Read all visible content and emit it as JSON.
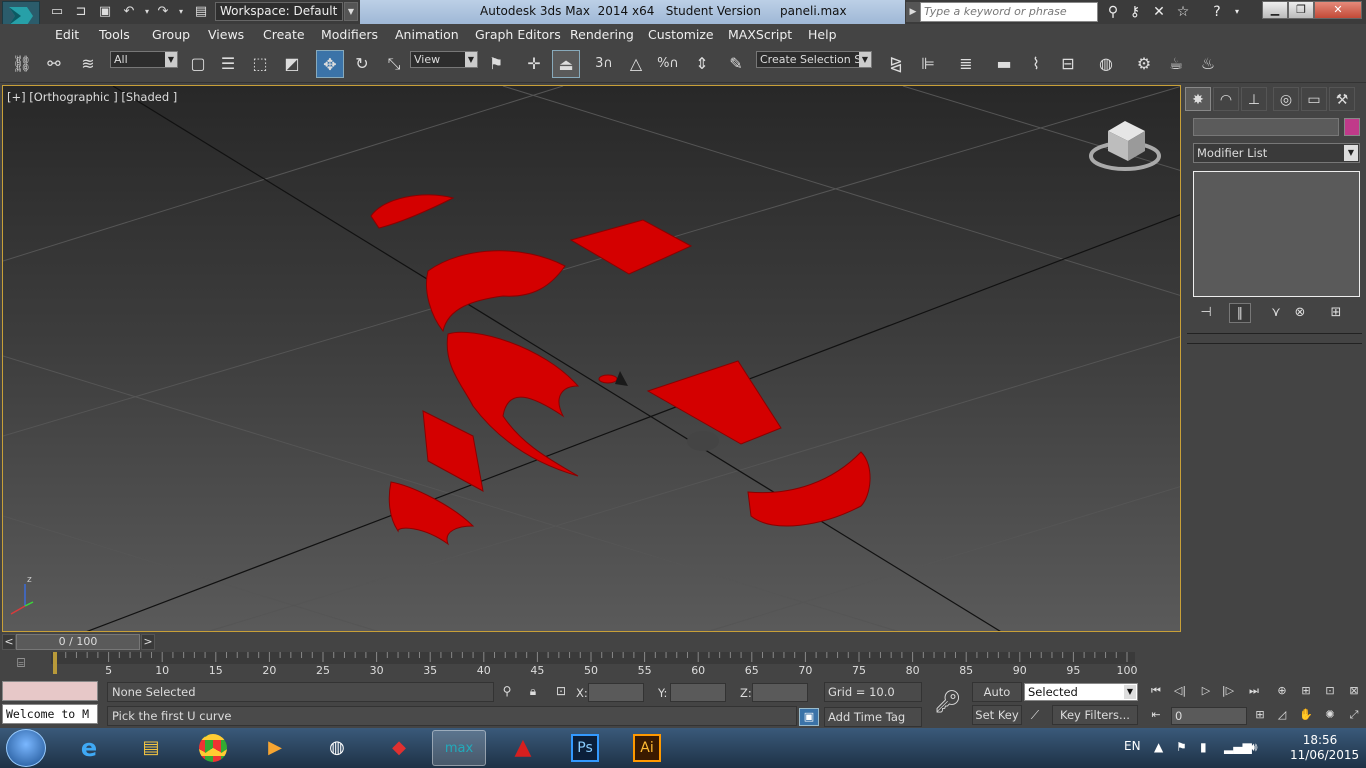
{
  "title": {
    "workspace": "Workspace: Default",
    "app_title": "Autodesk 3ds Max  2014 x64   Student Version     paneli.max",
    "search_placeholder": "Type a keyword or phrase"
  },
  "menu": [
    "Edit",
    "Tools",
    "Group",
    "Views",
    "Create",
    "Modifiers",
    "Animation",
    "Graph Editors",
    "Rendering",
    "Customize",
    "MAXScript",
    "Help"
  ],
  "toolbar": {
    "selection_filter": "All",
    "ref_coord": "View",
    "snap_angle": "3",
    "snap_percent": "%",
    "selection_set": "Create Selection Se"
  },
  "viewport": {
    "label": "[+] [Orthographic ] [Shaded ]",
    "axis_z": "z",
    "part_color": "#d40000",
    "border_color": "#c8a038"
  },
  "command_panel": {
    "modifier_list": "Modifier List",
    "swatch_color": "#c03a8a"
  },
  "time_slider": {
    "position": "0 / 100",
    "prev": "<",
    "next": ">"
  },
  "timeline": {
    "ticks": [
      "0",
      "5",
      "10",
      "15",
      "20",
      "25",
      "30",
      "35",
      "40",
      "45",
      "50",
      "55",
      "60",
      "65",
      "70",
      "75",
      "80",
      "85",
      "90",
      "95",
      "100"
    ]
  },
  "status": {
    "selection": "None Selected",
    "prompt": "Pick the first U curve",
    "script_text": "Welcome to M",
    "x_label": "X:",
    "y_label": "Y:",
    "z_label": "Z:",
    "grid": "Grid = 10.0",
    "add_time_tag": "Add Time Tag",
    "auto_key": "Auto Key",
    "set_key": "Set Key",
    "key_mode": "Selected",
    "key_filters": "Key Filters...",
    "current_frame": "0"
  },
  "taskbar": {
    "lang": "EN",
    "time": "18:56",
    "date": "11/06/2015",
    "apps": [
      "ie-icon",
      "explorer-icon",
      "chrome-icon",
      "media-player-icon",
      "popcorn-icon",
      "sketchup-icon",
      "3dsmax-icon",
      "autocad-icon",
      "photoshop-icon",
      "illustrator-icon"
    ],
    "app_labels": {
      "max": "max",
      "ps": "Ps",
      "ai": "Ai"
    }
  }
}
